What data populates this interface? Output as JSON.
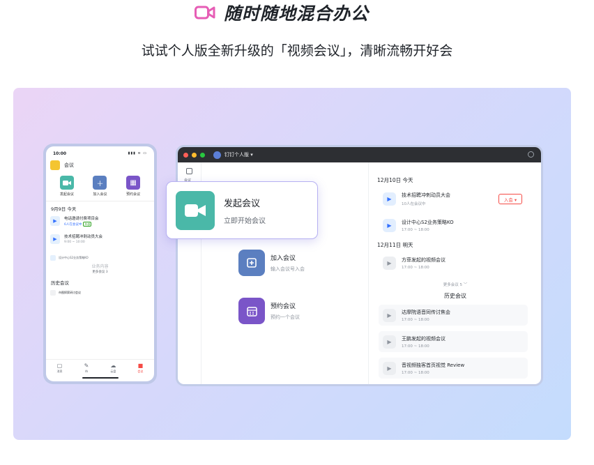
{
  "header": {
    "title": "随时随地混合办公",
    "subtitle": "试试个人版全新升级的「视频会议」，清晰流畅开好会"
  },
  "colors": {
    "accent_pink": "#e65db5",
    "teal": "#4ab8a8",
    "blue": "#5b7fc0",
    "purple": "#7a55c8",
    "danger": "#f54a45"
  },
  "phone": {
    "time": "10:00",
    "signal": "▮▮▮ ≋ ▭",
    "title": "会议",
    "actions": [
      {
        "label": "发起会议",
        "icon": "video-icon"
      },
      {
        "label": "加入会议",
        "icon": "plus-icon"
      },
      {
        "label": "预约会议",
        "icon": "calendar-icon"
      }
    ],
    "date_header": "9月9日 今天",
    "items": [
      {
        "title": "电话邀请付费项目会",
        "live": "6人在会议中",
        "tag": "外部"
      },
      {
        "title": "技术招聘冲刺动员大会",
        "time": "9:00 ~ 10:00"
      }
    ],
    "small_item": "设计中心S2业务策略KO",
    "watermark": "业务内容",
    "more": "更多会议 3",
    "history_header": "历史会议",
    "history_item": "市图探索研讨会议",
    "tabs": [
      {
        "label": "消息",
        "icon": "chat-icon"
      },
      {
        "label": "待",
        "icon": "pen-icon"
      },
      {
        "label": "云盘",
        "icon": "cloud-icon"
      },
      {
        "label": "会议",
        "icon": "video-icon"
      }
    ]
  },
  "desktop": {
    "app_name": "钉钉个人版 ▾",
    "side_label": "会议",
    "actions": [
      {
        "title": "加入会议",
        "subtitle": "输入会议号入会",
        "icon": "plus-icon"
      },
      {
        "title": "预约会议",
        "subtitle": "预约一个会议",
        "icon": "calendar-icon"
      }
    ],
    "day1": "12月10日 今天",
    "day1_items": [
      {
        "title": "技术招聘冲刺动员大会",
        "sub": "10人在会议中",
        "join": "入会 ▾"
      },
      {
        "title": "设计中心S2业务策略KO",
        "sub": "17:00 ~ 18:00"
      }
    ],
    "day2": "12月11日 明天",
    "day2_items": [
      {
        "title": "方菲发起的视频会议",
        "sub": "17:00 ~ 18:00"
      }
    ],
    "more": "更多会议 5 ﹀",
    "history_header": "历史会议",
    "history_items": [
      {
        "title": "达摩院语音同传讨焦会",
        "sub": "17:00 ~ 18:00"
      },
      {
        "title": "王鹏发起的视频会议",
        "sub": "17:00 ~ 18:00"
      },
      {
        "title": "音视频独客首页视觉 Review",
        "sub": "17:00 ~ 18:00"
      }
    ]
  },
  "popup": {
    "title": "发起会议",
    "subtitle": "立即开始会议",
    "icon": "video-icon"
  }
}
